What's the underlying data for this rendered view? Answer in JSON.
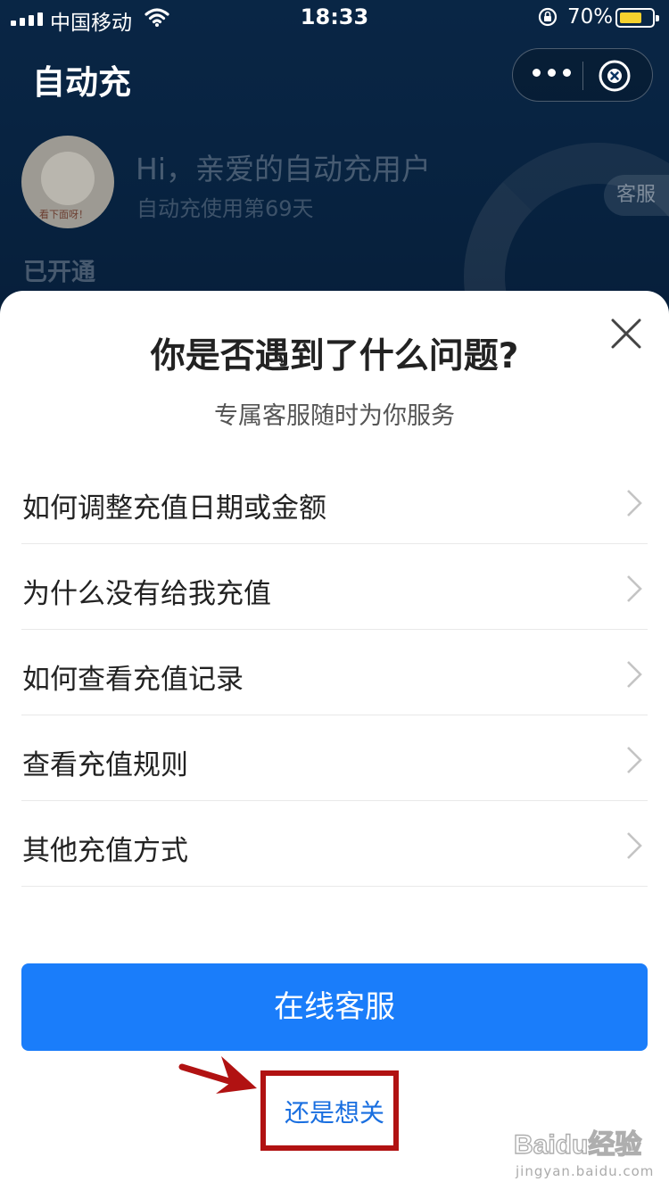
{
  "status_bar": {
    "carrier": "中国移动",
    "time": "18:33",
    "battery_percent": "70%",
    "battery_level": 0.7,
    "signal_bars": 4
  },
  "header": {
    "title": "自动充",
    "more_icon": "more-icon",
    "close_icon": "close-circle-icon"
  },
  "background": {
    "greeting": "Hi，亲爱的自动充用户",
    "usage_days": "自动充使用第69天",
    "opened_status": "已开通",
    "service_tag": "客服",
    "avatar_sticker": "看下面呀！"
  },
  "sheet": {
    "title": "你是否遇到了什么问题?",
    "subtitle": "专属客服随时为你服务",
    "faq": [
      {
        "label": "如何调整充值日期或金额"
      },
      {
        "label": "为什么没有给我充值"
      },
      {
        "label": "如何查看充值记录"
      },
      {
        "label": "查看充值规则"
      },
      {
        "label": "其他充值方式"
      }
    ],
    "primary_button": "在线客服",
    "secondary_link": "还是想关"
  },
  "watermark": {
    "logo_text": "Baidu经验",
    "url": "jingyan.baidu.com"
  },
  "colors": {
    "primary": "#1a7dfa",
    "link": "#1a6fe0",
    "header_bg": "#0f3b6b",
    "annotation": "#b11212",
    "battery": "#f6d12e"
  }
}
